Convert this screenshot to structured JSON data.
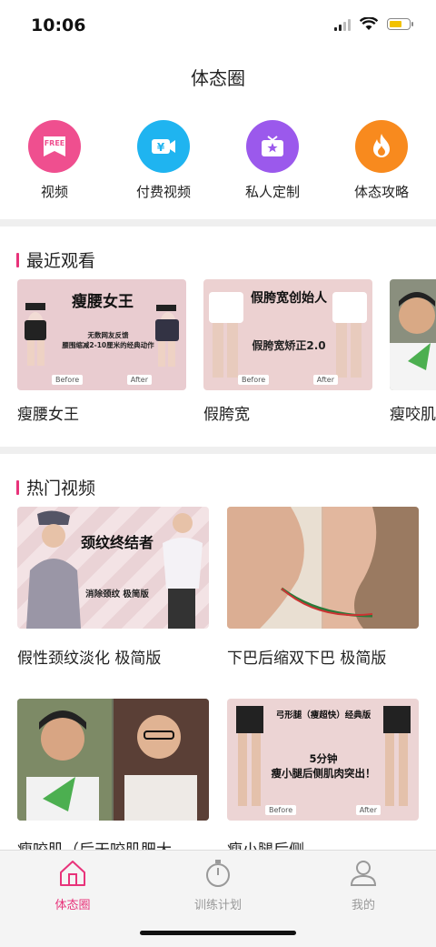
{
  "status_bar": {
    "time": "10:06",
    "battery_color": "#f2c200"
  },
  "page": {
    "title": "体态圈"
  },
  "quick_links": [
    {
      "label": "视频",
      "icon": "free-video-icon",
      "color": "#ef4f8f",
      "badge": "FREE"
    },
    {
      "label": "付费视频",
      "icon": "paid-video-icon",
      "color": "#1fb4f0",
      "badge": "¥"
    },
    {
      "label": "私人定制",
      "icon": "custom-tv-icon",
      "color": "#9b59ec"
    },
    {
      "label": "体态攻略",
      "icon": "flame-icon",
      "color": "#f88a1e"
    }
  ],
  "recent": {
    "title": "最近观看",
    "items": [
      {
        "label": "瘦腰女王",
        "thumb_title": "瘦腰女王",
        "thumb_sub": "无数网友反馈\n腰围缩减2-10厘米的经典动作",
        "before": "Before",
        "after": "After"
      },
      {
        "label": "假胯宽",
        "thumb_title": "假胯宽创始人",
        "thumb_sub": "假胯宽矫正2.0",
        "before": "Before",
        "after": "After"
      },
      {
        "label": "瘦咬肌"
      }
    ]
  },
  "hot": {
    "title": "热门视频",
    "items": [
      {
        "label": "假性颈纹淡化 极简版",
        "thumb_title": "颈纹终结者",
        "thumb_sub": "消除颈纹 极简版"
      },
      {
        "label": "下巴后缩双下巴 极简版"
      },
      {
        "label": "瘦咬肌（后天咬肌肥大"
      },
      {
        "label": "瘦小腿后侧",
        "thumb_title": "弓形腿（瘦超快）经典版",
        "thumb_sub": "5分钟\n瘦小腿后侧肌肉突出！",
        "before": "Before",
        "after": "After"
      }
    ]
  },
  "tabbar": {
    "accent": "#e8337a",
    "tabs": [
      {
        "label": "体态圈",
        "icon": "home-icon",
        "active": true
      },
      {
        "label": "训练计划",
        "icon": "stopwatch-icon",
        "active": false
      },
      {
        "label": "我的",
        "icon": "profile-icon",
        "active": false
      }
    ]
  }
}
